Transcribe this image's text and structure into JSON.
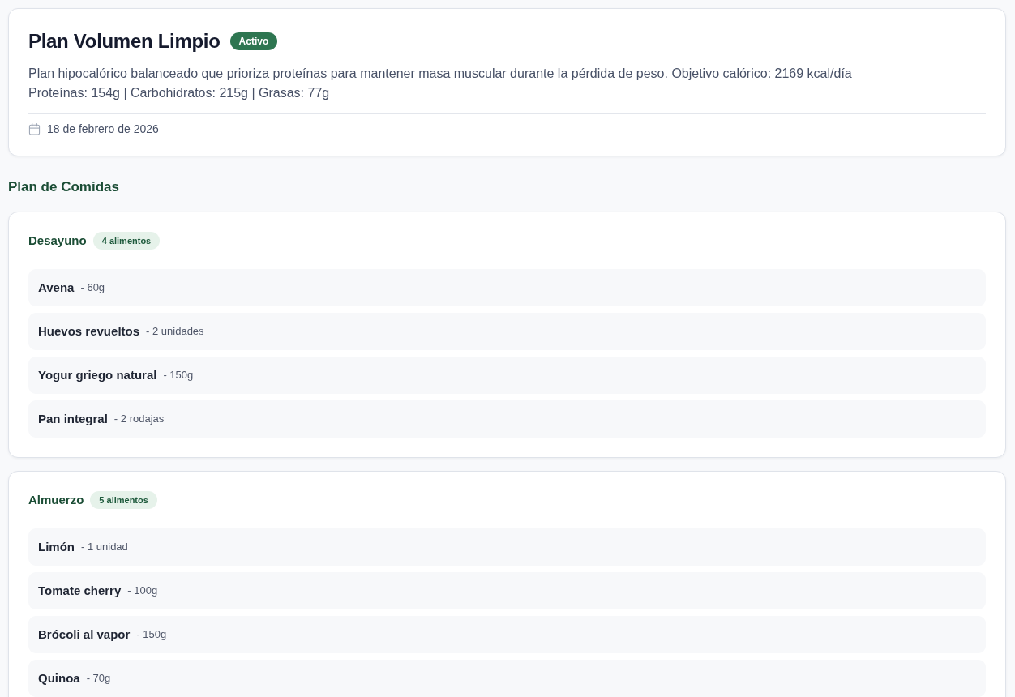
{
  "plan": {
    "title": "Plan Volumen Limpio",
    "status": "Activo",
    "description": "Plan hipocalórico balanceado que prioriza proteínas para mantener masa muscular durante la pérdida de peso. Objetivo calórico: 2169 kcal/día\nProteínas: 154g | Carbohidratos: 215g | Grasas: 77g",
    "date": "18 de febrero de 2026"
  },
  "meals_heading": "Plan de Comidas",
  "meals": [
    {
      "name": "Desayuno",
      "count": "4 alimentos",
      "foods": [
        {
          "name": "Avena",
          "quantity": "- 60g"
        },
        {
          "name": "Huevos revueltos",
          "quantity": "- 2 unidades"
        },
        {
          "name": "Yogur griego natural",
          "quantity": "- 150g"
        },
        {
          "name": "Pan integral",
          "quantity": "- 2 rodajas"
        }
      ]
    },
    {
      "name": "Almuerzo",
      "count": "5 alimentos",
      "foods": [
        {
          "name": "Limón",
          "quantity": "- 1 unidad"
        },
        {
          "name": "Tomate cherry",
          "quantity": "- 100g"
        },
        {
          "name": "Brócoli al vapor",
          "quantity": "- 150g"
        },
        {
          "name": "Quinoa",
          "quantity": "- 70g"
        }
      ]
    }
  ]
}
